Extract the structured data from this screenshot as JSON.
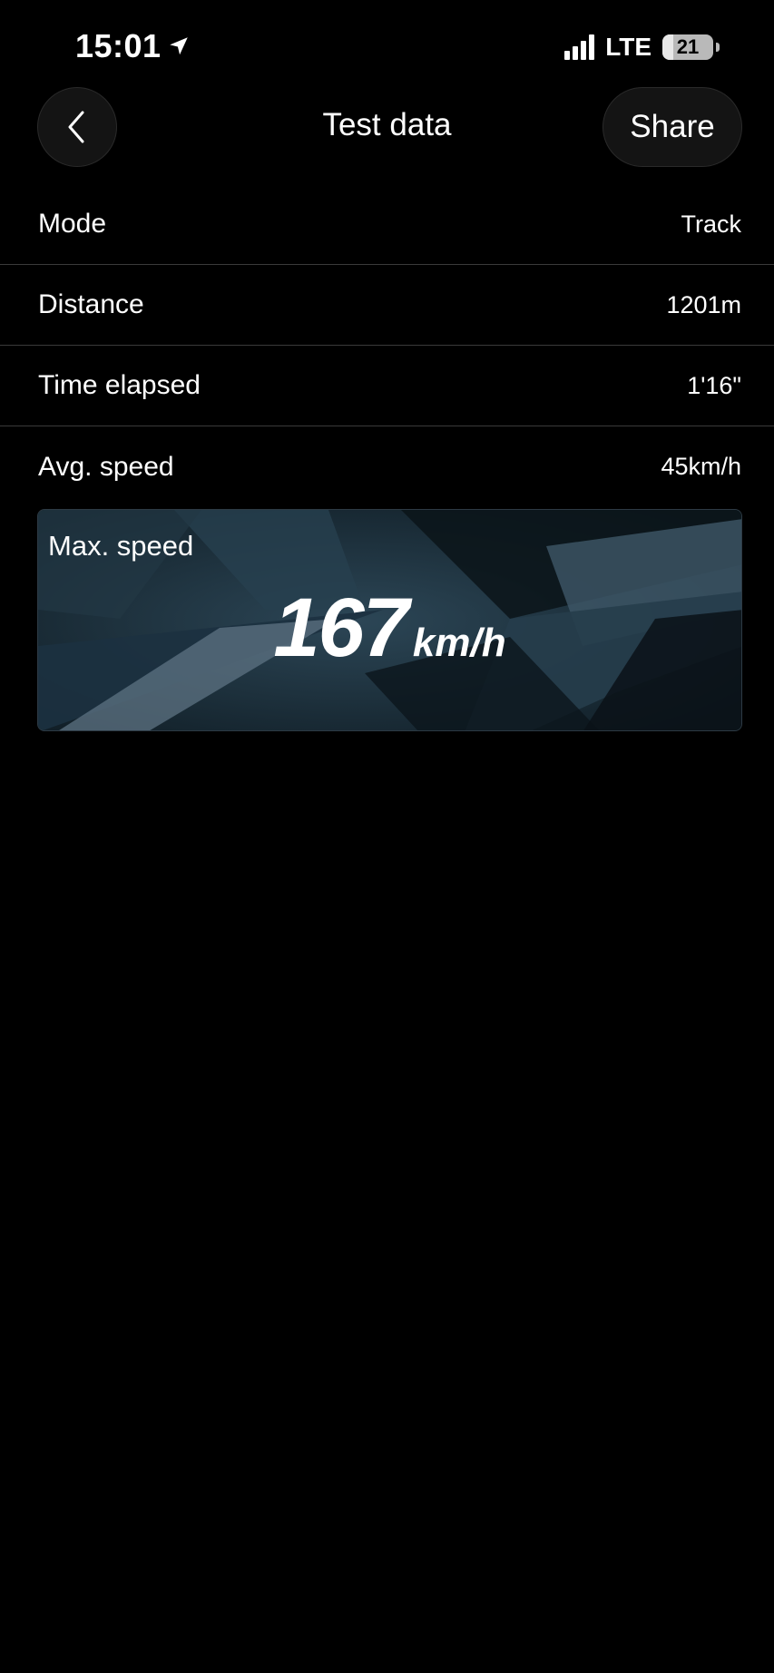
{
  "status_bar": {
    "time": "15:01",
    "network": "LTE",
    "battery": "21",
    "battery_level": 0.21,
    "icons": [
      "location-arrow-icon",
      "signal-icon",
      "battery-icon"
    ]
  },
  "nav": {
    "title": "Test data",
    "share_label": "Share",
    "back_icon": "chevron-left-icon"
  },
  "rows": [
    {
      "label": "Mode",
      "value": "Track"
    },
    {
      "label": "Distance",
      "value": "1201m"
    },
    {
      "label": "Time elapsed",
      "value": "1'16\""
    },
    {
      "label": "Avg. speed",
      "value": "45km/h"
    }
  ],
  "max_speed": {
    "label": "Max. speed",
    "value": "167",
    "unit": "km/h"
  },
  "colors": {
    "background": "#000000",
    "card_background": "#14222b",
    "divider": "#3a3a3a",
    "text": "#ffffff"
  }
}
